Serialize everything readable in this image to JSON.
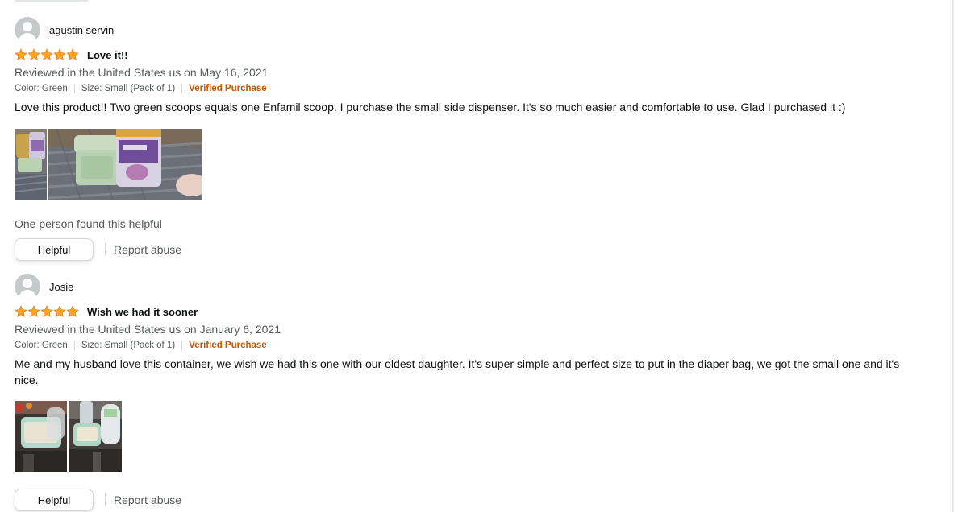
{
  "reviews": [
    {
      "profile_name": "agustin servin",
      "rating": 5,
      "title": "Love it!!",
      "date_line": "Reviewed in the United States us on May 16, 2021",
      "color": "Color: Green",
      "size": "Size: Small (Pack of 1)",
      "verified": "Verified Purchase",
      "body": "Love this product!! Two green scoops equals one Enfamil scoop. I purchase the small side dispenser. It's so much easier and comfortable to use. Glad I purchased it :)",
      "helpful_count": "One person found this helpful",
      "helpful_label": "Helpful",
      "report_label": "Report abuse"
    },
    {
      "profile_name": "Josie",
      "rating": 5,
      "title": "Wish we had it sooner",
      "date_line": "Reviewed in the United States us on January 6, 2021",
      "color": "Color: Green",
      "size": "Size: Small (Pack of 1)",
      "verified": "Verified Purchase",
      "body": "Me and my husband love this container, we wish we had this one with our oldest daughter. It's super simple and perfect size to put in the diaper bag, we got the small one and it's nice.",
      "helpful_label": "Helpful",
      "report_label": "Report abuse"
    }
  ],
  "colors": {
    "star": "#ffa41c",
    "verified": "#c45500",
    "secondary_text": "#565959"
  }
}
